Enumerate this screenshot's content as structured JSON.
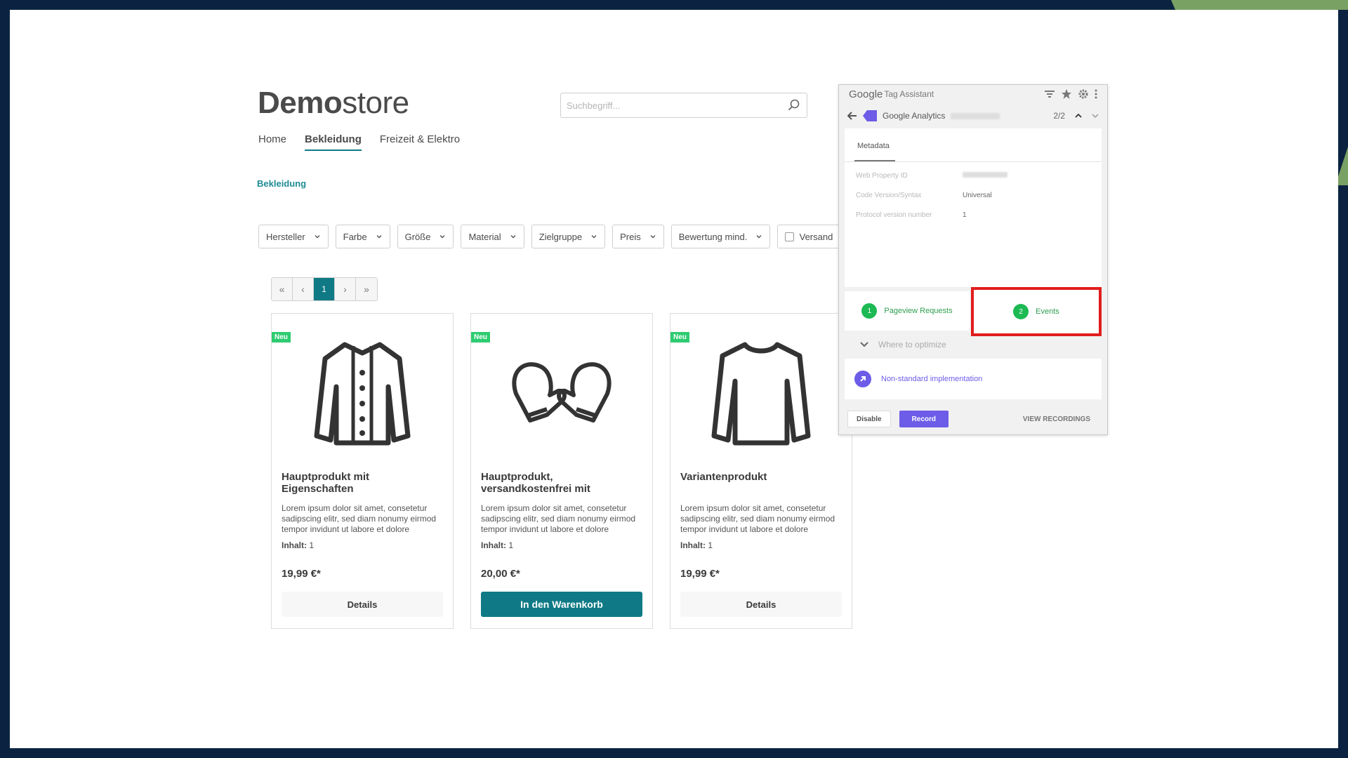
{
  "colors": {
    "brand_teal": "#0f7a86",
    "badge_green": "#2ecc71",
    "ta_purple": "#6c5ce7",
    "highlight_red": "#e11d1d"
  },
  "shop": {
    "logo_bold": "Demo",
    "logo_regular": "store",
    "search_placeholder": "Suchbegriff...",
    "nav": [
      {
        "label": "Home"
      },
      {
        "label": "Bekleidung"
      },
      {
        "label": "Freizeit & Elektro"
      }
    ],
    "breadcrumb": "Bekleidung",
    "filters": [
      "Hersteller",
      "Farbe",
      "Größe",
      "Material",
      "Zielgruppe",
      "Preis",
      "Bewertung mind."
    ],
    "filter_checkbox_label": "Versand",
    "pager": {
      "first": "«",
      "prev": "‹",
      "current": "1",
      "next": "›",
      "last": "»"
    },
    "products": [
      {
        "badge": "Neu",
        "name": "Hauptprodukt mit Eigenschaften",
        "desc": "Lorem ipsum dolor sit amet, consetetur sadipscing elitr, sed diam nonumy eirmod tempor invidunt ut labore et dolore",
        "content_label": "Inhalt:",
        "content_value": "1",
        "price": "19,99 €*",
        "button": "Details",
        "image_icon": "jacket-icon"
      },
      {
        "badge": "Neu",
        "name": "Hauptprodukt, versandkostenfrei mit",
        "desc": "Lorem ipsum dolor sit amet, consetetur sadipscing elitr, sed diam nonumy eirmod tempor invidunt ut labore et dolore",
        "content_label": "Inhalt:",
        "content_value": "1",
        "price": "20,00 €*",
        "button": "In den Warenkorb",
        "image_icon": "mittens-icon"
      },
      {
        "badge": "Neu",
        "name": "Variantenprodukt",
        "desc": "Lorem ipsum dolor sit amet, consetetur sadipscing elitr, sed diam nonumy eirmod tempor invidunt ut labore et dolore",
        "content_label": "Inhalt:",
        "content_value": "1",
        "price": "19,99 €*",
        "button": "Details",
        "image_icon": "sweater-icon"
      }
    ]
  },
  "tag_assistant": {
    "google": "Google",
    "title": "Tag Assistant",
    "tag_name": "Google Analytics",
    "counter": "2/2",
    "tab": "Metadata",
    "metadata": [
      {
        "key": "Web Property ID",
        "value": ""
      },
      {
        "key": "Code Version/Syntax",
        "value": "Universal"
      },
      {
        "key": "Protocol version number",
        "value": "1"
      }
    ],
    "pageview": {
      "count": "1",
      "label": "Pageview Requests"
    },
    "events": {
      "count": "2",
      "label": "Events"
    },
    "where_label": "Where to optimize",
    "nonstandard": "Non-standard implementation",
    "disable": "Disable",
    "record": "Record",
    "view_recordings": "VIEW RECORDINGS"
  }
}
